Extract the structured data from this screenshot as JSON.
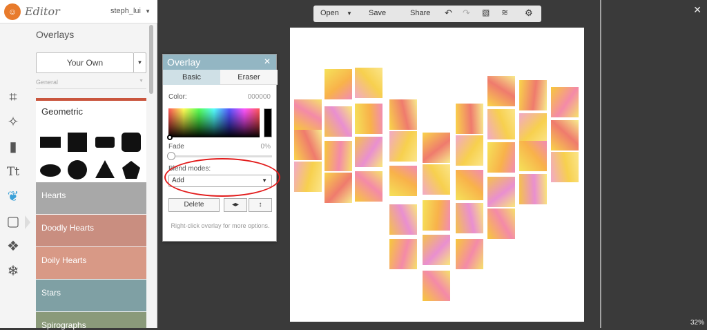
{
  "app": {
    "title": "Editor",
    "user": "steph_lui"
  },
  "panel": {
    "title": "Overlays",
    "dropdown_value": "Your Own",
    "filter_label": "General",
    "geometric_title": "Geometric",
    "categories": [
      "Hearts",
      "Doodly Hearts",
      "Doily Hearts",
      "Stars",
      "Spirographs"
    ]
  },
  "canvas_toolbar": {
    "open": "Open",
    "save": "Save",
    "share": "Share"
  },
  "dialog": {
    "title": "Overlay",
    "tab_basic": "Basic",
    "tab_eraser": "Eraser",
    "color_label": "Color:",
    "color_value": "000000",
    "fade_label": "Fade",
    "fade_value": "0%",
    "blend_label": "Blend modes:",
    "blend_value": "Add",
    "delete_label": "Delete",
    "hint": "Right-click overlay for more options."
  },
  "zoom": "32%",
  "colors": {
    "accent": "#3aa0d8",
    "dialog_header": "#93b6c3",
    "highlight": "#e21c1c"
  }
}
